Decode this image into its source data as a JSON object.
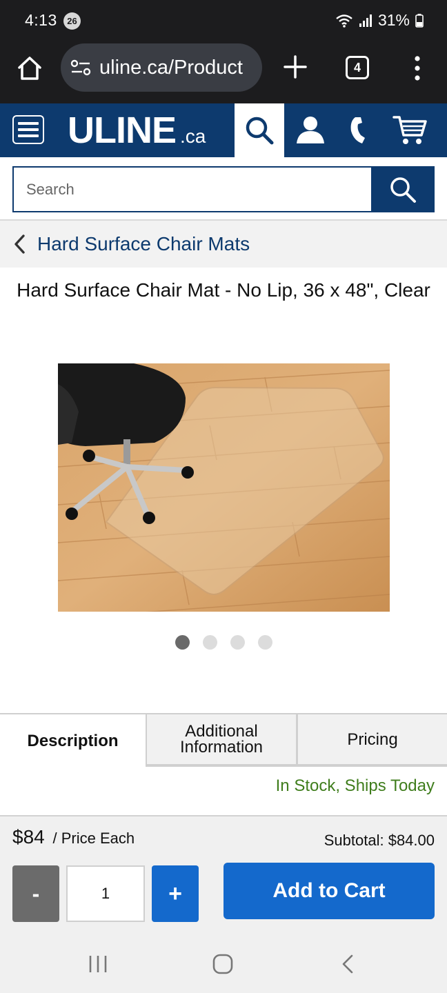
{
  "status_bar": {
    "time": "4:13",
    "notification_count": "26",
    "battery": "31%"
  },
  "browser": {
    "url": "uline.ca/Product",
    "tab_count": "4"
  },
  "header": {
    "logo_main": "ULINE",
    "logo_suffix": ".ca",
    "brand_color": "#0d3a6e"
  },
  "search": {
    "placeholder": "Search",
    "value": ""
  },
  "breadcrumb": {
    "label": "Hard Surface Chair Mats"
  },
  "product": {
    "title": "Hard Surface Chair Mat - No Lip, 36 x 48\", Clear",
    "carousel": {
      "total": 4,
      "active_index": 0
    }
  },
  "tabs": [
    {
      "label": "Description",
      "active": true
    },
    {
      "label": "Additional Information",
      "active": false
    },
    {
      "label": "Pricing",
      "active": false
    }
  ],
  "stock": {
    "text": "In Stock, Ships Today",
    "color": "#3f7d1c"
  },
  "purchase": {
    "price": "$84",
    "price_unit": "/ Price Each",
    "subtotal": "Subtotal: $84.00",
    "minus_label": "-",
    "quantity": "1",
    "plus_label": "+",
    "add_to_cart_label": "Add to Cart",
    "accent_color": "#1469cc"
  },
  "system_nav": {
    "icons": [
      "recents-icon",
      "home-icon",
      "back-icon"
    ]
  }
}
